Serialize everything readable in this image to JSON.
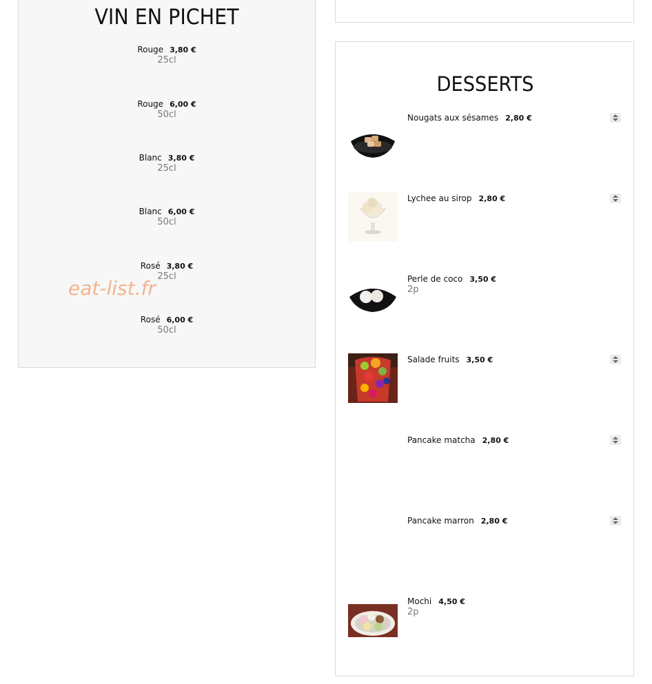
{
  "wine": {
    "title": "VIN EN PICHET",
    "items": [
      {
        "name": "Rouge",
        "price": "3,80 €",
        "volume": "25cl"
      },
      {
        "name": "Rouge",
        "price": "6,00 €",
        "volume": "50cl"
      },
      {
        "name": "Blanc",
        "price": "3,80 €",
        "volume": "25cl"
      },
      {
        "name": "Blanc",
        "price": "6,00 €",
        "volume": "50cl"
      },
      {
        "name": "Rosé",
        "price": "3,80 €",
        "volume": "25cl"
      },
      {
        "name": "Rosé",
        "price": "6,00 €",
        "volume": "50cl"
      }
    ]
  },
  "desserts": {
    "title": "DESSERTS",
    "items": [
      {
        "name": "Nougats aux sésames",
        "price": "2,80 €",
        "sub": "",
        "image": "nougat-photo",
        "stepper": true
      },
      {
        "name": "Lychee au sirop",
        "price": "2,80 €",
        "sub": "",
        "image": "lychee-photo",
        "stepper": true
      },
      {
        "name": "Perle de coco",
        "price": "3,50 €",
        "sub": "2p",
        "image": "coconut-pearl-photo",
        "stepper": false
      },
      {
        "name": "Salade fruits",
        "price": "3,50 €",
        "sub": "",
        "image": "fruit-salad-photo",
        "stepper": true
      },
      {
        "name": "Pancake matcha",
        "price": "2,80 €",
        "sub": "",
        "image": "",
        "stepper": true
      },
      {
        "name": "Pancake marron",
        "price": "2,80 €",
        "sub": "",
        "image": "",
        "stepper": true
      },
      {
        "name": "Mochi",
        "price": "4,50 €",
        "sub": "2p",
        "image": "mochi-photo",
        "stepper": false
      }
    ]
  },
  "watermark": "eat-list.fr"
}
